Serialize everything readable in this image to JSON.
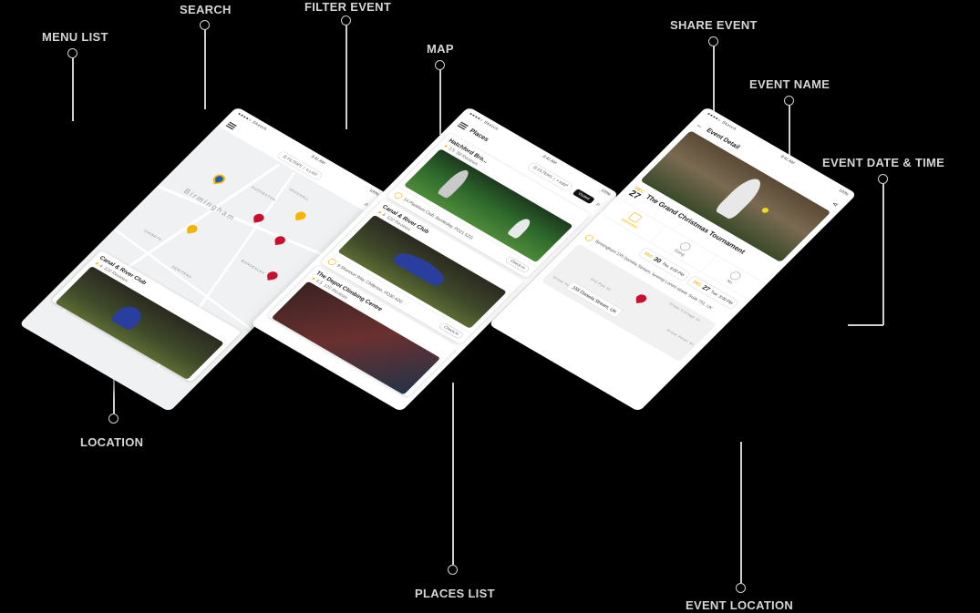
{
  "callouts": {
    "menu_list": "MENU LIST",
    "search": "SEARCH",
    "filter_event": "FILTER EVENT",
    "map": "MAP",
    "share_event": "SHARE EVENT",
    "event_name": "EVENT NAME",
    "event_date_time": "EVENT DATE & TIME",
    "location": "LOCATION",
    "places_list": "PLACES LIST",
    "event_location": "EVENT LOCATION"
  },
  "status_bar": {
    "carrier": "Sketch",
    "time": "9:41 AM",
    "battery": "100%"
  },
  "map_screen": {
    "filters_label": "FILTERS",
    "list_label": "LIST",
    "city_label": "Birmingham",
    "districts": [
      "VAUXHALL",
      "DUDDESTON",
      "DIGBETH",
      "DERITEND",
      "BORDESLEY",
      "ASTON"
    ],
    "card": {
      "title": "Canal & River Club",
      "rating": "4",
      "reviews": "120 Reviews",
      "checkin": "Check-In"
    }
  },
  "places_screen": {
    "title": "Places",
    "filters_label": "FILTERS",
    "map_label": "MAP",
    "visited_label": "Visited",
    "items": [
      {
        "title": "Hatchford Bro...",
        "rating": "3.5",
        "reviews": "88 Reviews",
        "address": "14 Pladdium Club, Bordesley, PO21 5ZG",
        "checkin": "Check-In"
      },
      {
        "title": "Canal & River Club",
        "rating": "4",
        "reviews": "120 Reviews",
        "address": "9 Shannon Way, Chillerton, PO30 4ZG",
        "checkin": "Check-In"
      },
      {
        "title": "The Depot Climbing Centre",
        "rating": "4.5",
        "reviews": "120 Reviews"
      }
    ]
  },
  "event_screen": {
    "title": "Event Detail",
    "date_month": "DEC",
    "date_day": "27",
    "event_name": "The Grand Christmas Tournament",
    "rsvp": {
      "interested": "Interested",
      "going": "Going",
      "no": "No"
    },
    "slots": [
      {
        "month": "DEC",
        "day": "30",
        "weekday": "Thu",
        "time": "6:00 PM"
      },
      {
        "month": "DEC",
        "day": "27",
        "weekday": "Tue",
        "time": "3:00 PM"
      }
    ],
    "location_text": "Birmingham 155 Daniela Stream, loremip Lorem street, Suite 751, UK",
    "map_streets": [
      "Great College St",
      "Old Pye St",
      "Great Peter St",
      "Great Pe"
    ],
    "map_address": "155 Daniela Stream, UK"
  },
  "colors": {
    "accent": "#f4b400",
    "pin_red": "#c8102e",
    "background": "#000000"
  }
}
